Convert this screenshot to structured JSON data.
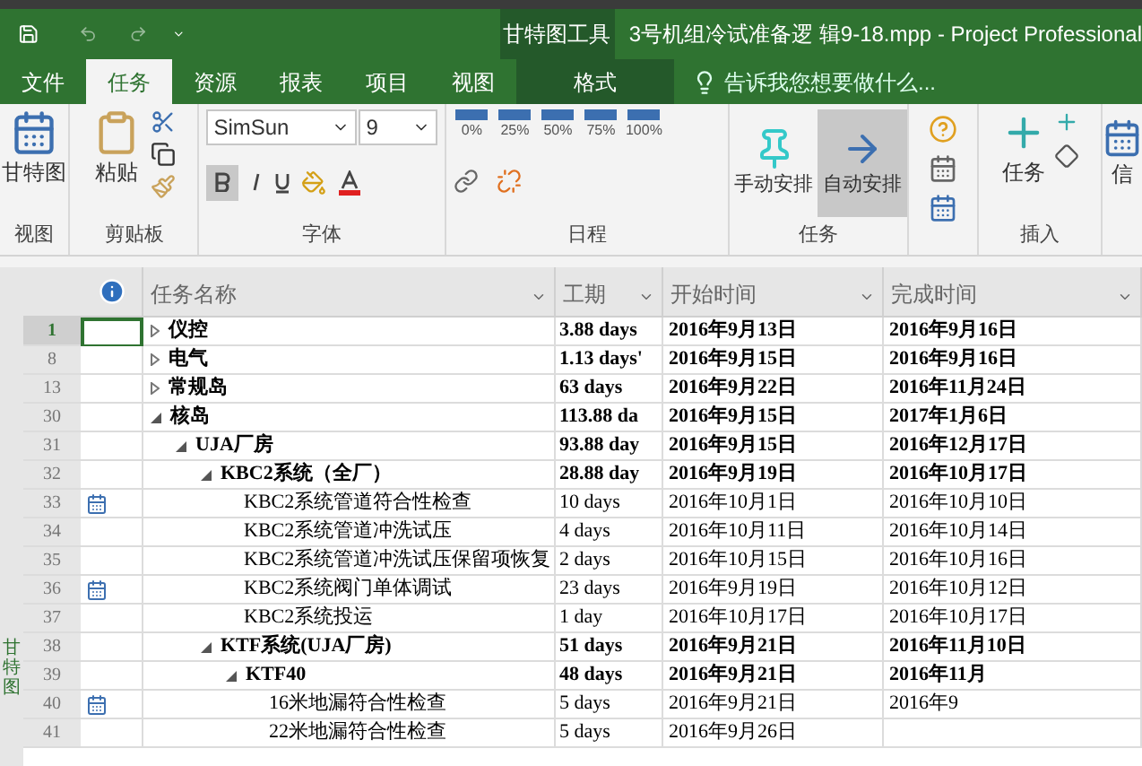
{
  "window": {
    "title": "3号机组冷试准备逻 辑9-18.mpp - Project Professional",
    "context_tab_group": "甘特图工具"
  },
  "tabs": [
    {
      "label": "文件",
      "selected": false
    },
    {
      "label": "任务",
      "selected": true
    },
    {
      "label": "资源",
      "selected": false
    },
    {
      "label": "报表",
      "selected": false
    },
    {
      "label": "项目",
      "selected": false
    },
    {
      "label": "视图",
      "selected": false
    },
    {
      "label": "格式",
      "selected": false,
      "kind": "context"
    }
  ],
  "tell_me": {
    "placeholder": "告诉我您想要做什么..."
  },
  "ribbon": {
    "view_group": {
      "button": "甘特图",
      "label": "视图"
    },
    "clipboard_group": {
      "button": "粘贴",
      "label": "剪贴板"
    },
    "font_group": {
      "font_name": "SimSun",
      "font_size": "9",
      "bold_selected": true,
      "label": "字体"
    },
    "schedule_group": {
      "percents": [
        "0%",
        "25%",
        "50%",
        "75%",
        "100%"
      ],
      "label": "日程"
    },
    "tasks_group": {
      "buttons": [
        {
          "label": "手动安排",
          "selected": false
        },
        {
          "label": "自动安排",
          "selected": true
        }
      ],
      "label": "任务"
    },
    "insert_group": {
      "button": "任务",
      "label": "插入"
    },
    "cut_button": "信"
  },
  "side_label": "甘特图",
  "table": {
    "columns": [
      "任务名称",
      "工期",
      "开始时间",
      "完成时间"
    ],
    "rows": [
      {
        "id": "1",
        "name": "仪控",
        "expanded": false,
        "calendar_icon": false,
        "selected": true,
        "duration": "3.88 days",
        "start": "2016年9月13日",
        "finish": "2016年9月16日"
      },
      {
        "id": "8",
        "name": "电气",
        "expanded": false,
        "calendar_icon": false,
        "selected": false,
        "duration": "1.13 days'",
        "start": "2016年9月15日",
        "finish": "2016年9月16日"
      },
      {
        "id": "13",
        "name": "常规岛",
        "expanded": false,
        "calendar_icon": false,
        "selected": false,
        "duration": "63 days",
        "start": "2016年9月22日",
        "finish": "2016年11月24日"
      },
      {
        "id": "30",
        "name": "核岛",
        "expanded": true,
        "calendar_icon": false,
        "selected": false,
        "duration": "113.88 da",
        "start": "2016年9月15日",
        "finish": "2017年1月6日",
        "children": [
          {
            "id": "31",
            "name": "UJA厂房",
            "expanded": true,
            "calendar_icon": false,
            "selected": false,
            "duration": "93.88 day",
            "start": "2016年9月15日",
            "finish": "2016年12月17日",
            "children": [
              {
                "id": "32",
                "name": "KBC2系统（全厂）",
                "expanded": true,
                "calendar_icon": false,
                "selected": false,
                "duration": "28.88 day",
                "start": "2016年9月19日",
                "finish": "2016年10月17日",
                "children": [
                  {
                    "id": "33",
                    "name": "KBC2系统管道符合性检查",
                    "calendar_icon": true,
                    "selected": false,
                    "duration": "10 days",
                    "start": "2016年10月1日",
                    "finish": "2016年10月10日"
                  },
                  {
                    "id": "34",
                    "name": "KBC2系统管道冲洗试压",
                    "calendar_icon": false,
                    "selected": false,
                    "duration": "4 days",
                    "start": "2016年10月11日",
                    "finish": "2016年10月14日"
                  },
                  {
                    "id": "35",
                    "name": "KBC2系统管道冲洗试压保留项恢复",
                    "calendar_icon": false,
                    "selected": false,
                    "duration": "2 days",
                    "start": "2016年10月15日",
                    "finish": "2016年10月16日"
                  },
                  {
                    "id": "36",
                    "name": "KBC2系统阀门单体调试",
                    "calendar_icon": true,
                    "selected": false,
                    "duration": "23 days",
                    "start": "2016年9月19日",
                    "finish": "2016年10月12日"
                  },
                  {
                    "id": "37",
                    "name": "KBC2系统投运",
                    "calendar_icon": false,
                    "selected": false,
                    "duration": "1 day",
                    "start": "2016年10月17日",
                    "finish": "2016年10月17日"
                  }
                ]
              },
              {
                "id": "38",
                "name": "KTF系统(UJA厂房)",
                "expanded": true,
                "calendar_icon": false,
                "selected": false,
                "duration": "51 days",
                "start": "2016年9月21日",
                "finish": "2016年11月10日",
                "children": [
                  {
                    "id": "39",
                    "name": "KTF40",
                    "expanded": true,
                    "calendar_icon": false,
                    "selected": false,
                    "duration": "48 days",
                    "start": "2016年9月21日",
                    "finish": "2016年11月",
                    "children": [
                      {
                        "id": "40",
                        "name": "16米地漏符合性检查",
                        "calendar_icon": true,
                        "selected": false,
                        "duration": "5 days",
                        "start": "2016年9月21日",
                        "finish": "2016年9"
                      },
                      {
                        "id": "41",
                        "name": "22米地漏符合性检查",
                        "calendar_icon": false,
                        "selected": false,
                        "duration": "5 days",
                        "start": "2016年9月26日"
                      }
                    ]
                  }
                ]
              }
            ]
          }
        ]
      }
    ]
  }
}
